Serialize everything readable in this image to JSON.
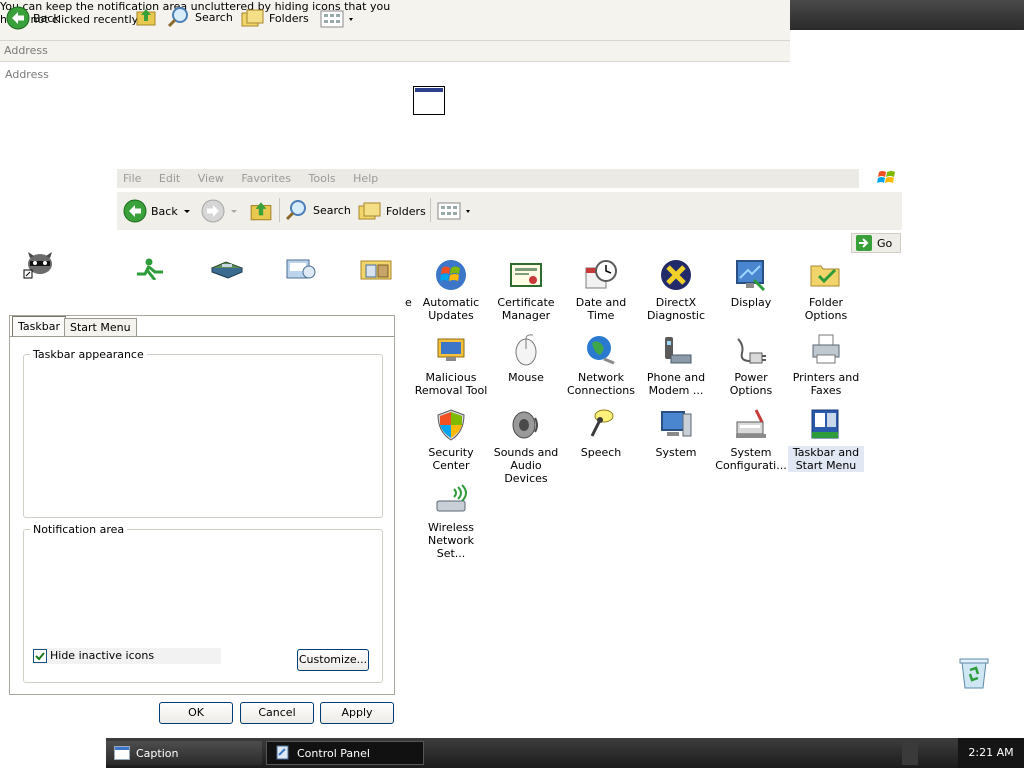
{
  "ghost": {
    "tip_line1": "You can keep the notification area uncluttered by hiding icons that you",
    "tip_line2": "have not clicked recently.",
    "back_label": "Back",
    "search_label": "Search",
    "folders_label": "Folders",
    "address_label_1": "Address",
    "address_label_2": "Address"
  },
  "menubar": {
    "items": [
      "File",
      "Edit",
      "View",
      "Favorites",
      "Tools",
      "Help"
    ]
  },
  "toolbar": {
    "back_label": "Back",
    "search_label": "Search",
    "folders_label": "Folders",
    "go_label": "Go"
  },
  "control_panel": {
    "partial_label": "e",
    "items": [
      {
        "label": "Automatic Updates",
        "icon": "automatic-updates-icon"
      },
      {
        "label": "Certificate Manager",
        "icon": "certificate-icon"
      },
      {
        "label": "Date and Time",
        "icon": "clock-icon"
      },
      {
        "label": "DirectX Diagnostic",
        "icon": "directx-icon"
      },
      {
        "label": "Display",
        "icon": "display-icon"
      },
      {
        "label": "Folder Options",
        "icon": "folder-options-icon"
      },
      {
        "label": "Malicious Removal Tool",
        "icon": "malicious-removal-icon"
      },
      {
        "label": "Mouse",
        "icon": "mouse-icon"
      },
      {
        "label": "Network Connections",
        "icon": "network-globe-icon"
      },
      {
        "label": "Phone and Modem ...",
        "icon": "phone-modem-icon"
      },
      {
        "label": "Power Options",
        "icon": "power-plug-icon"
      },
      {
        "label": "Printers and Faxes",
        "icon": "printer-icon"
      },
      {
        "label": "Security Center",
        "icon": "shield-icon"
      },
      {
        "label": "Sounds and Audio Devices",
        "icon": "speaker-icon"
      },
      {
        "label": "Speech",
        "icon": "microphone-icon"
      },
      {
        "label": "System",
        "icon": "system-computer-icon"
      },
      {
        "label": "System Configurati...",
        "icon": "system-config-icon"
      },
      {
        "label": "Taskbar and Start Menu",
        "icon": "taskbar-icon"
      },
      {
        "label": "Wireless Network Set...",
        "icon": "wireless-icon"
      }
    ]
  },
  "dialog": {
    "tab_taskbar": "Taskbar",
    "tab_start_menu": "Start Menu",
    "group_appearance": "Taskbar appearance",
    "group_notification": "Notification area",
    "hide_inactive_label": "Hide inactive icons",
    "hide_inactive_checked": true,
    "customize_label": "Customize...",
    "ok_label": "OK",
    "cancel_label": "Cancel",
    "apply_label": "Apply"
  },
  "taskbar": {
    "task1_label": "Caption",
    "task2_label": "Control Panel",
    "clock": "2:21 AM"
  }
}
